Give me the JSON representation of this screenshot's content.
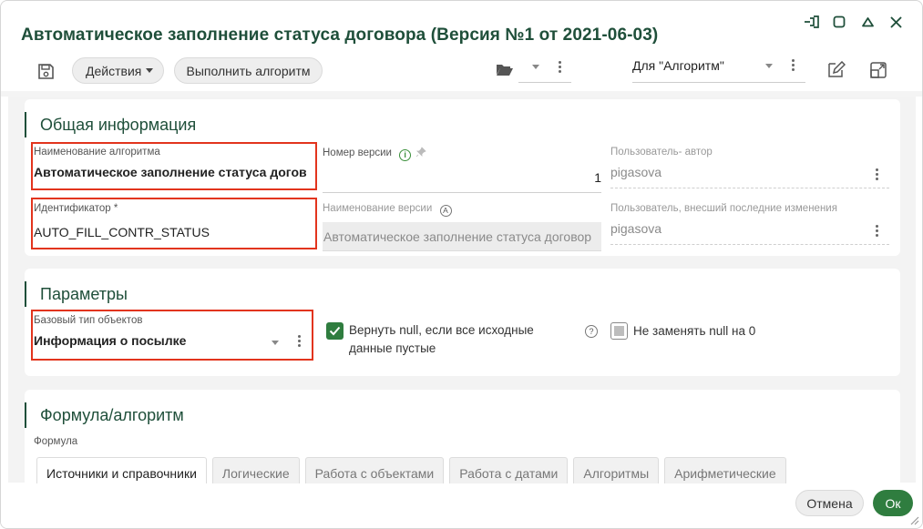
{
  "window": {
    "title": "Автоматическое заполнение статуса договора (Версия №1 от 2021-06-03)"
  },
  "toolbar": {
    "actions_label": "Действия",
    "run_label": "Выполнить алгоритм",
    "view_value": "Для \"Алгоритм\""
  },
  "general": {
    "title": "Общая информация",
    "algo_name": {
      "label": "Наименование алгоритма",
      "value": "Автоматическое заполнение статуса догов"
    },
    "identifier": {
      "label": "Идентификатор *",
      "value": "AUTO_FILL_CONTR_STATUS"
    },
    "version_number": {
      "label": "Номер версии",
      "value": "1"
    },
    "version_name": {
      "label": "Наименование версии",
      "value": "Автоматическое заполнение статуса договор"
    },
    "author": {
      "label": "Пользователь- автор",
      "value": "pigasova"
    },
    "last_editor": {
      "label": "Пользователь, внесший последние изменения",
      "value": "pigasova"
    }
  },
  "params": {
    "title": "Параметры",
    "base_type": {
      "label": "Базовый тип объектов",
      "value": "Информация о посылке"
    },
    "return_null": {
      "label_line1": "Вернуть null, если все исходные",
      "label_line2": "данные пустые",
      "checked": true
    },
    "no_replace_null": {
      "label": "Не заменять null на 0",
      "checked": false
    }
  },
  "formula": {
    "title": "Формула/алгоритм",
    "sublabel": "Формула",
    "tabs": [
      "Источники и справочники",
      "Логические",
      "Работа с объектами",
      "Работа с датами",
      "Алгоритмы",
      "Арифметические"
    ]
  },
  "footer": {
    "cancel_label": "Отмена",
    "ok_label": "Ок"
  },
  "colors": {
    "accent": "#1f4f3a",
    "primary_button": "#2f7d3f",
    "highlight_box": "#e2341d"
  }
}
